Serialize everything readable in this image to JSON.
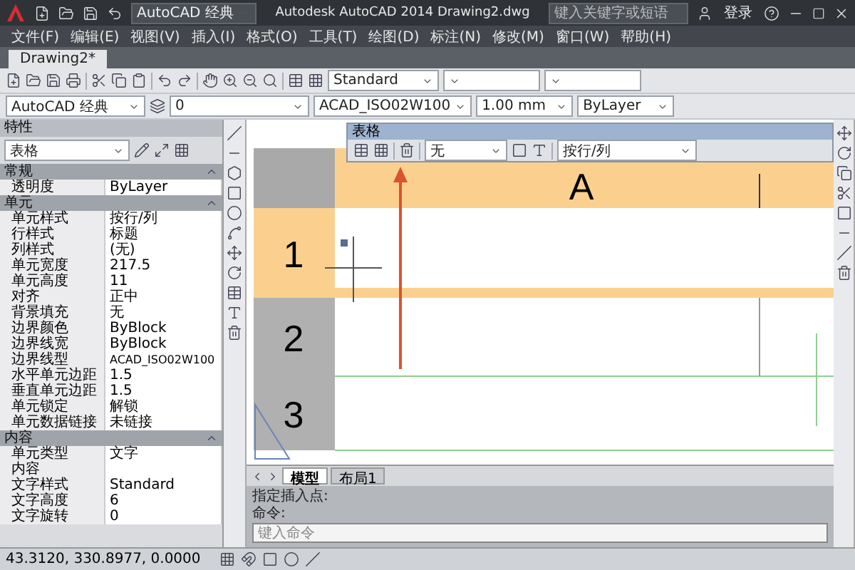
{
  "title_bar": {
    "workspace": "AutoCAD 经典",
    "title": "Autodesk AutoCAD 2014    Drawing2.dwg",
    "search": {
      "placeholder": "键入关键字或短语"
    },
    "sign_in": "登录"
  },
  "menu": [
    "文件(F)",
    "编辑(E)",
    "视图(V)",
    "插入(I)",
    "格式(O)",
    "工具(T)",
    "绘图(D)",
    "标注(N)",
    "修改(M)",
    "窗口(W)",
    "帮助(H)"
  ],
  "file_tabs": [
    {
      "label": "Drawing2*",
      "selected": true
    }
  ],
  "toolbar": {
    "text_style": "Standard",
    "workspace": "AutoCAD 经典",
    "layer": "0",
    "linetype": "ACAD_ISO02W100",
    "lineweight": "1.00 mm",
    "plot_style": "ByLayer"
  },
  "properties": {
    "title": "特性",
    "selector": "表格",
    "sections": [
      {
        "title": "常规",
        "expanded": true,
        "rows": [
          {
            "label": "透明度",
            "value": "ByLayer"
          }
        ]
      },
      {
        "title": "单元",
        "expanded": true,
        "rows": [
          {
            "label": "单元样式",
            "value": "按行/列"
          },
          {
            "label": "行样式",
            "value": "标题"
          },
          {
            "label": "列样式",
            "value": "(无)"
          },
          {
            "label": "单元宽度",
            "value": "217.5"
          },
          {
            "label": "单元高度",
            "value": "11"
          },
          {
            "label": "对齐",
            "value": "正中"
          },
          {
            "label": "背景填充",
            "value": "无"
          },
          {
            "label": "边界颜色",
            "value": "ByBlock"
          },
          {
            "label": "边界线宽",
            "value": "ByBlock"
          },
          {
            "label": "边界线型",
            "value": "ACAD_ISO02W100"
          },
          {
            "label": "水平单元边距",
            "value": "1.5"
          },
          {
            "label": "垂直单元边距",
            "value": "1.5"
          },
          {
            "label": "单元锁定",
            "value": "解锁"
          },
          {
            "label": "单元数据链接",
            "value": "未链接"
          }
        ]
      },
      {
        "title": "内容",
        "expanded": true,
        "rows": [
          {
            "label": "单元类型",
            "value": "文字"
          },
          {
            "label": "内容"
          },
          {
            "label": "文字样式",
            "value": "Standard"
          },
          {
            "label": "文字高度",
            "value": "6"
          },
          {
            "label": "文字旋转",
            "value": "0"
          }
        ]
      }
    ]
  },
  "table_toolbar": {
    "title": "表格",
    "border": "无",
    "cell_style": "按行/列"
  },
  "drawing": {
    "header": {
      "label": "A",
      "selected": true
    },
    "rows": [
      {
        "label": "1",
        "selected": true
      },
      {
        "label": "2",
        "selected": false
      },
      {
        "label": "3",
        "selected": false
      }
    ]
  },
  "layout_tabs": [
    {
      "label": "模型",
      "selected": true
    },
    {
      "label": "布局1",
      "selected": false
    }
  ],
  "command": {
    "history": [
      "指定插入点:",
      "命令:"
    ],
    "placeholder": "键入命令"
  },
  "status_bar": {
    "coordinates": "43.3120, 330.8977, 0.0000"
  }
}
